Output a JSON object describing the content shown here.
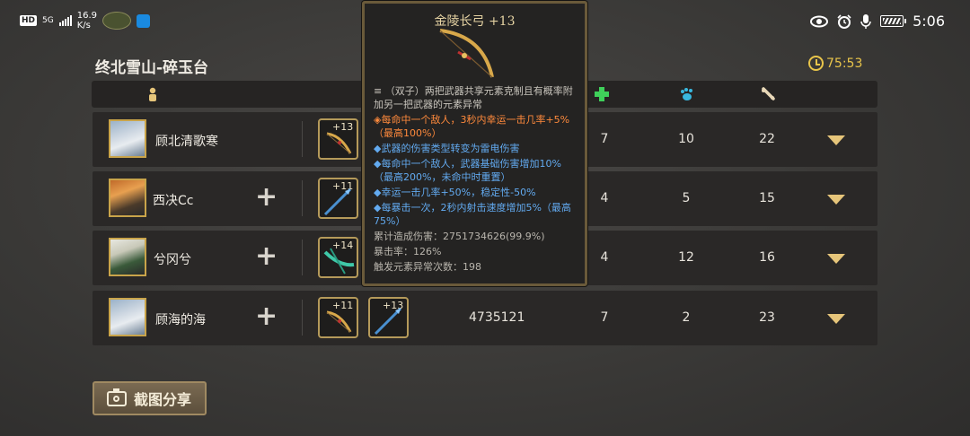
{
  "status_bar": {
    "hd": "HD",
    "network": "5G",
    "speed_value": "16.9",
    "speed_unit": "K/s",
    "time": "5:06"
  },
  "header": {
    "title": "终北雪山-碎玉台",
    "timer": "75:53"
  },
  "columns": {
    "icons": [
      "player-icon",
      "heal-icon",
      "paw-icon",
      "bone-icon"
    ],
    "colors": {
      "player": "#e6c57a",
      "heal": "#3fd05a",
      "paw": "#39b8e0",
      "bone": "#e8d8b8"
    }
  },
  "rows": [
    {
      "name": "顾北清歌寒",
      "show_add": false,
      "weapons": [
        {
          "level": "+13",
          "type": "bow"
        }
      ],
      "damage": "",
      "heal": "7",
      "paw": "10",
      "bone": "22"
    },
    {
      "name": "西决Cc",
      "show_add": true,
      "weapons": [
        {
          "level": "+11",
          "type": "spear"
        }
      ],
      "damage": "",
      "heal": "4",
      "paw": "5",
      "bone": "15"
    },
    {
      "name": "兮冈兮",
      "show_add": true,
      "weapons": [
        {
          "level": "+14",
          "type": "crossbow"
        }
      ],
      "damage": "",
      "heal": "4",
      "paw": "12",
      "bone": "16"
    },
    {
      "name": "顾海的海",
      "show_add": true,
      "weapons": [
        {
          "level": "+11",
          "type": "bow"
        },
        {
          "level": "+13",
          "type": "spear"
        }
      ],
      "damage": "4735121",
      "heal": "7",
      "paw": "2",
      "bone": "23"
    }
  ],
  "share_button": {
    "label": "截图分享"
  },
  "tooltip": {
    "title": "金陵长弓 +13",
    "lines": [
      {
        "bullet": "≡",
        "text": "（双子）两把武器共享元素克制且有概率附加另一把武器的元素异常",
        "color": "gray"
      },
      {
        "bullet": "◈",
        "text": "每命中一个敌人，3秒内幸运一击几率+5%（最高100%）",
        "color": "orange"
      },
      {
        "bullet": "◆",
        "text": "武器的伤害类型转变为雷电伤害",
        "color": "blue"
      },
      {
        "bullet": "◆",
        "text": "每命中一个敌人，武器基础伤害增加10%（最高200%，未命中时重置）",
        "color": "blue"
      },
      {
        "bullet": "◆",
        "text": "幸运一击几率+50%，稳定性-50%",
        "color": "blue"
      },
      {
        "bullet": "◆",
        "text": "每暴击一次，2秒内射击速度增加5%（最高75%）",
        "color": "blue"
      }
    ],
    "stats": [
      "累计造成伤害：2751734626(99.9%)",
      "暴击率：126%",
      "触发元素异常次数：198"
    ]
  }
}
